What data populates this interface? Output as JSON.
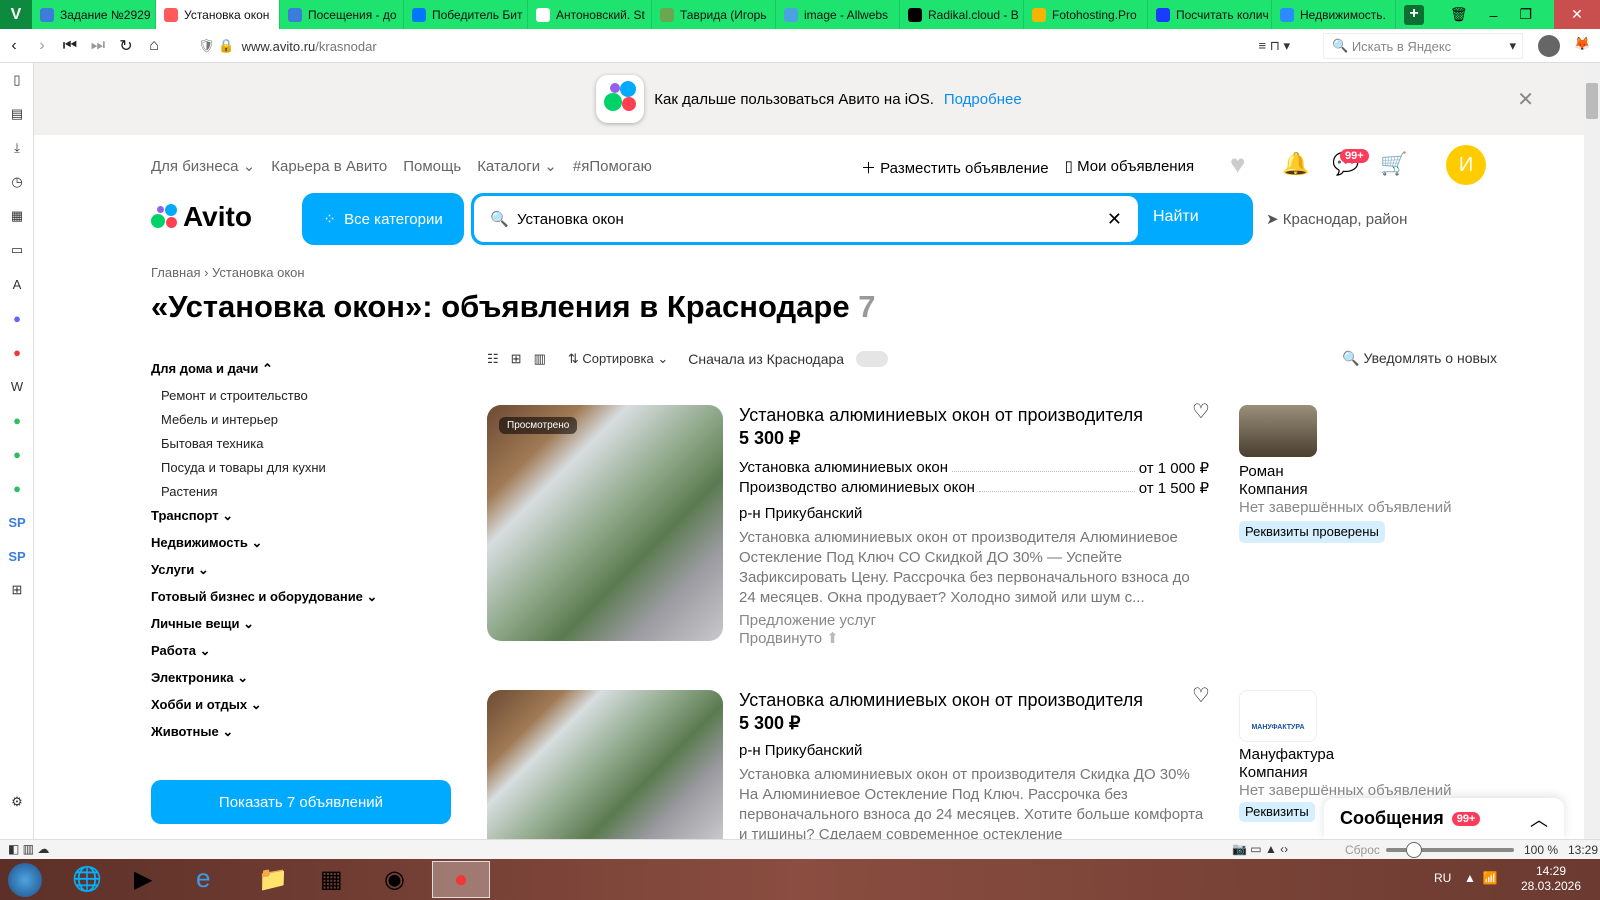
{
  "browser": {
    "tabs": [
      {
        "label": "Задание №2929",
        "icon": "sp-icon",
        "color": "#3b7dd8"
      },
      {
        "label": "Установка окон",
        "icon": "avito-icon",
        "color": "#ff5a5a",
        "active": true
      },
      {
        "label": "Посещения - до",
        "icon": "sp-icon",
        "color": "#3b7dd8"
      },
      {
        "label": "Победитель Бит",
        "icon": "vk-icon",
        "color": "#0077ff"
      },
      {
        "label": "Антоновский. St",
        "icon": "document-icon",
        "color": "#ffffff"
      },
      {
        "label": "Таврида (Игорь",
        "icon": "image-icon",
        "color": "#6aa84f"
      },
      {
        "label": "image - Allwebs",
        "icon": "globe-icon",
        "color": "#4aa3df"
      },
      {
        "label": "Radikal.cloud - B",
        "icon": "r-icon",
        "color": "#000000"
      },
      {
        "label": "Fotohosting.Pro",
        "icon": "f-icon",
        "color": "#f4b400"
      },
      {
        "label": "Посчитать колич",
        "icon": "circle-icon",
        "color": "#1a3cff"
      },
      {
        "label": "Недвижимость.",
        "icon": "flower-icon",
        "color": "#2a8cff"
      }
    ],
    "url_domain": "www.avito.ru",
    "url_path": "/krasnodar",
    "search_placeholder": "Искать в Яндекс",
    "status": {
      "reset": "Сброс",
      "zoom": "100 %",
      "time": "13:29",
      "zoom_level": 100
    },
    "taskbar": {
      "lang": "RU",
      "time": "14:29",
      "date": "28.03.2026"
    }
  },
  "banner": {
    "text": "Как дальше пользоваться Авито на iOS.",
    "link": "Подробнее"
  },
  "topnav": {
    "items": [
      "Для бизнеса",
      "Карьера в Авито",
      "Помощь",
      "Каталоги",
      "#яПомогаю"
    ],
    "post": "Разместить объявление",
    "my": "Мои объявления",
    "badge": "99+",
    "avatar": "И"
  },
  "search": {
    "logo": "Avito",
    "all_categories": "Все категории",
    "query": "Установка окон",
    "find": "Найти",
    "location": "Краснодар, район"
  },
  "breadcrumb": [
    "Главная",
    "Установка окон"
  ],
  "heading": {
    "title": "«Установка окон»: объявления в Краснодаре",
    "count": "7"
  },
  "filters": {
    "open": "Для дома и дачи",
    "subs": [
      "Ремонт и строительство",
      "Мебель и интерьер",
      "Бытовая техника",
      "Посуда и товары для кухни",
      "Растения"
    ],
    "cats": [
      "Транспорт",
      "Недвижимость",
      "Услуги",
      "Готовый бизнес и оборудование",
      "Личные вещи",
      "Работа",
      "Электроника",
      "Хобби и отдых",
      "Животные"
    ],
    "show": "Показать 7 объявлений"
  },
  "toolbar": {
    "sort": "Сортировка",
    "local": "Сначала из Краснодара",
    "notify": "Уведомлять о новых"
  },
  "listings": [
    {
      "viewed": "Просмотрено",
      "title": "Установка алюминиевых окон от производителя",
      "price": "5 300 ₽",
      "services": [
        {
          "name": "Установка алюминиевых окон",
          "price": "от 1 000 ₽"
        },
        {
          "name": "Производство алюминиевых окон",
          "price": "от 1 500 ₽"
        }
      ],
      "district": "р-н Прикубанский",
      "desc": "Установка алюминиевых окон от производителя Алюминиевое Остекление Под Ключ СО Скидкой ДО 30% — Успейте Зафиксировать Цену. Рассрочка без первоначального взноса до 24 месяцев. Окна продувает? Холодно зимой или шум с...",
      "type": "Предложение услуг",
      "promoted": "Продвинуто",
      "seller": {
        "name": "Роман",
        "kind": "Компания",
        "note": "Нет завершённых объявлений",
        "badge": "Реквизиты проверены"
      }
    },
    {
      "title": "Установка алюминиевых окон от производителя",
      "price": "5 300 ₽",
      "district": "р-н Прикубанский",
      "desc": "Установка алюминиевых окон от производителя Скидка ДО 30% На Алюминиевое Остекление Под Ключ. Рассрочка без первоначального взноса до 24 месяцев. Хотите больше комфорта и тишины? Сделаем современное остекление",
      "seller": {
        "name": "Мануфактура",
        "kind": "Компания",
        "logo": "МАНУФАКТУРА",
        "note": "Нет завершённых объявлений",
        "badge": "Реквизиты"
      }
    }
  ],
  "messages": {
    "label": "Сообщения",
    "badge": "99+"
  }
}
